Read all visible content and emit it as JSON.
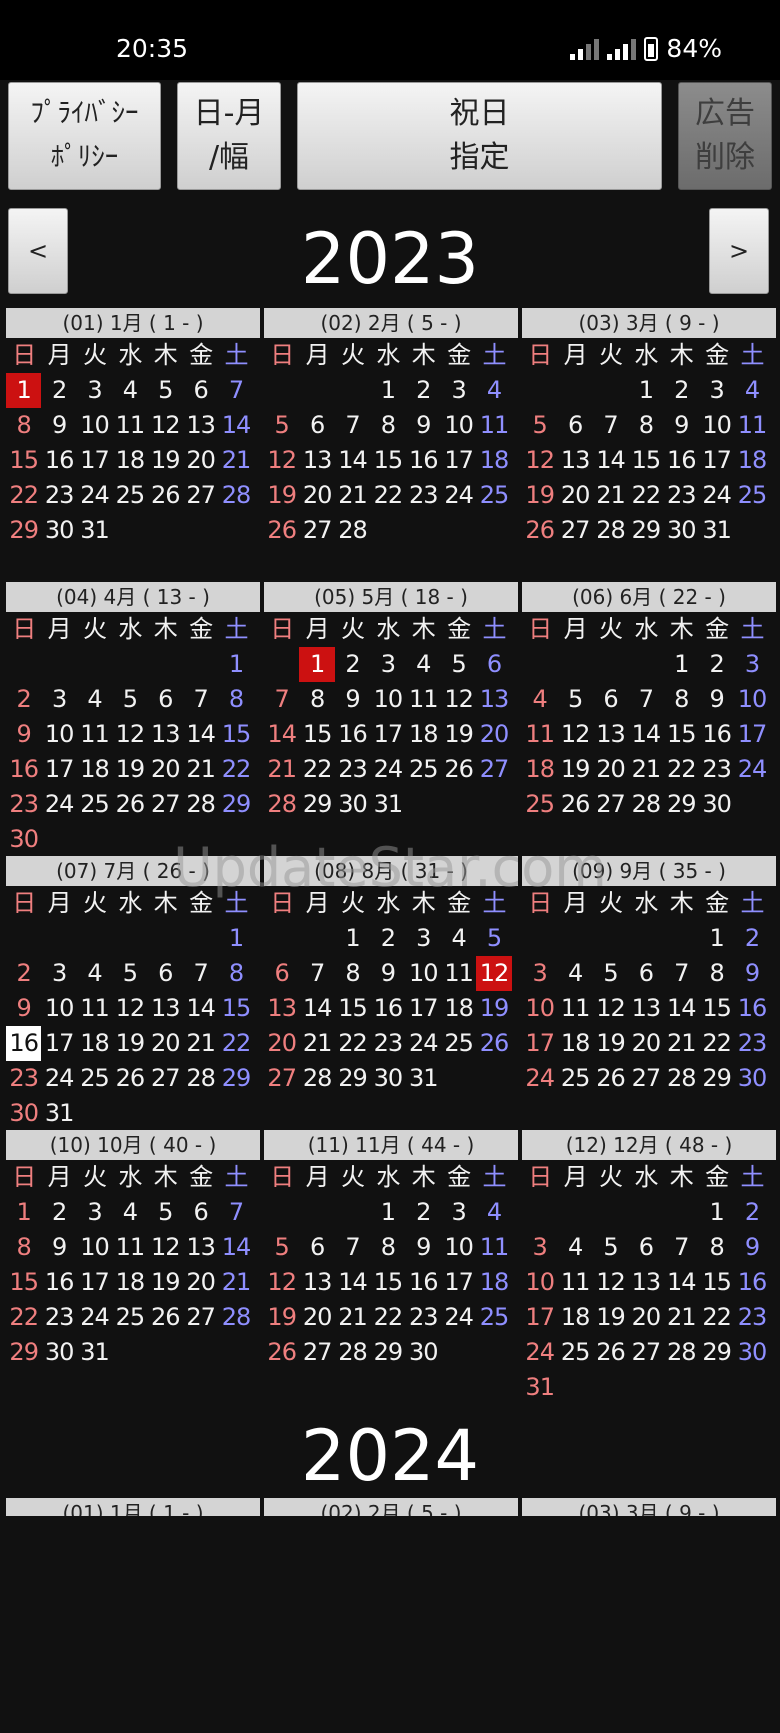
{
  "status_bar": {
    "time": "20:35",
    "battery": "84%"
  },
  "toolbar": {
    "privacy_label": "ﾌﾟﾗｲﾊﾞｼｰ\nﾎﾟﾘｼｰ",
    "day_month_label": "日-月\n/幅",
    "holiday_label": "祝日\n指定",
    "remove_ads_label": "広告\n削除"
  },
  "nav": {
    "prev_label": "<",
    "next_label": ">"
  },
  "weekday_labels": [
    "日",
    "月",
    "火",
    "水",
    "木",
    "金",
    "土"
  ],
  "years": [
    {
      "year": "2023",
      "months": [
        {
          "header": "(01) 1月 ( 1 - )",
          "start": 0,
          "days": 31,
          "red": [
            1
          ]
        },
        {
          "header": "(02) 2月 ( 5 - )",
          "start": 3,
          "days": 28,
          "red": []
        },
        {
          "header": "(03) 3月 ( 9 - )",
          "start": 3,
          "days": 31,
          "red": []
        },
        {
          "header": "(04) 4月 ( 13 - )",
          "start": 6,
          "days": 30,
          "red": []
        },
        {
          "header": "(05) 5月 ( 18 - )",
          "start": 1,
          "days": 31,
          "red": [
            1
          ]
        },
        {
          "header": "(06) 6月 ( 22 - )",
          "start": 4,
          "days": 30,
          "red": []
        },
        {
          "header": "(07) 7月 ( 26 - )",
          "start": 6,
          "days": 31,
          "red": [],
          "today": 16
        },
        {
          "header": "(08) 8月 ( 31 - )",
          "start": 2,
          "days": 31,
          "red": [
            12
          ]
        },
        {
          "header": "(09) 9月 ( 35 - )",
          "start": 5,
          "days": 30,
          "red": []
        },
        {
          "header": "(10) 10月 ( 40 - )",
          "start": 0,
          "days": 31,
          "red": []
        },
        {
          "header": "(11) 11月 ( 44 - )",
          "start": 3,
          "days": 30,
          "red": []
        },
        {
          "header": "(12) 12月 ( 48 - )",
          "start": 5,
          "days": 31,
          "red": []
        }
      ]
    },
    {
      "year": "2024",
      "months": [
        {
          "header": "(01) 1月 ( 1 - )"
        },
        {
          "header": "(02) 2月 ( 5 - )"
        },
        {
          "header": "(03) 3月 ( 9 - )"
        }
      ]
    }
  ],
  "watermark": "UpdateStar.com",
  "colors": {
    "sunday": "#ef7f7f",
    "saturday": "#8f8fff",
    "highlight": "#cc1111",
    "today": "#ffffff"
  }
}
